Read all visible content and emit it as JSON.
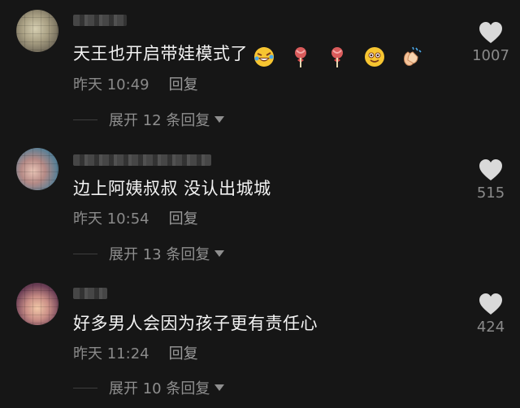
{
  "comments": [
    {
      "text": "天王也开启带娃模式了",
      "emojis": [
        "rofl-emoji",
        "lollipop-emoji",
        "lollipop-emoji",
        "smiling-face-emoji",
        "clapping-hands-emoji"
      ],
      "time": "昨天 10:49",
      "reply_label": "回复",
      "expand_label": "展开 12 条回复",
      "likes": "1007"
    },
    {
      "text": "边上阿姨叔叔 没认出城城",
      "emojis": [],
      "time": "昨天 10:54",
      "reply_label": "回复",
      "expand_label": "展开 13 条回复",
      "likes": "515"
    },
    {
      "text": "好多男人会因为孩子更有责任心",
      "emojis": [],
      "time": "昨天 11:24",
      "reply_label": "回复",
      "expand_label": "展开 10 条回复",
      "likes": "424"
    }
  ],
  "colors": {
    "background": "#161616",
    "primary_text": "#f2f2f2",
    "secondary_text": "#8a8a8a",
    "heart": "#d9d9d9"
  }
}
